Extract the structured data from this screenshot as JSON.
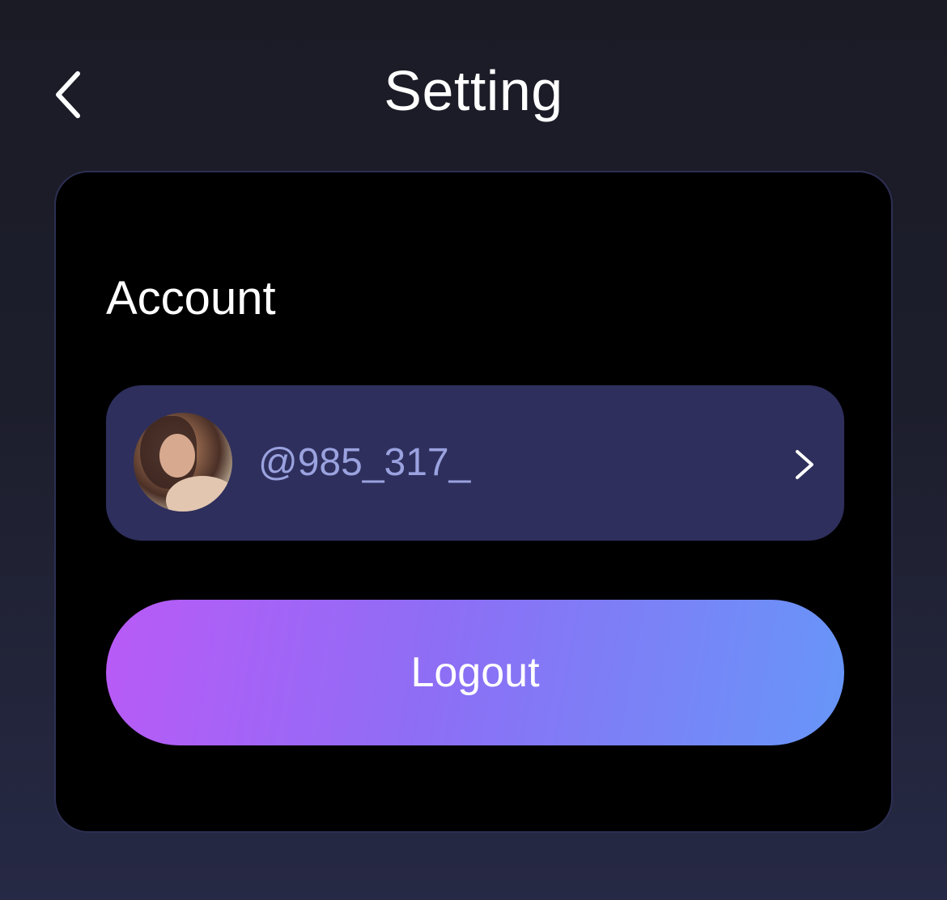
{
  "header": {
    "title": "Setting",
    "back_icon": "chevron-left-icon"
  },
  "card": {
    "section_title": "Account",
    "account": {
      "username": "@985_317_",
      "avatar": "user-avatar-photo",
      "chevron_icon": "chevron-right-icon"
    },
    "logout_label": "Logout"
  },
  "colors": {
    "background_top": "#1b1b26",
    "background_bottom": "#262945",
    "card_background": "#000000",
    "card_border": "#2c2f52",
    "account_row": "#2e2f5c",
    "username_text": "#9aa2df",
    "logout_gradient_start": "#b95af6",
    "logout_gradient_end": "#6796f8"
  }
}
